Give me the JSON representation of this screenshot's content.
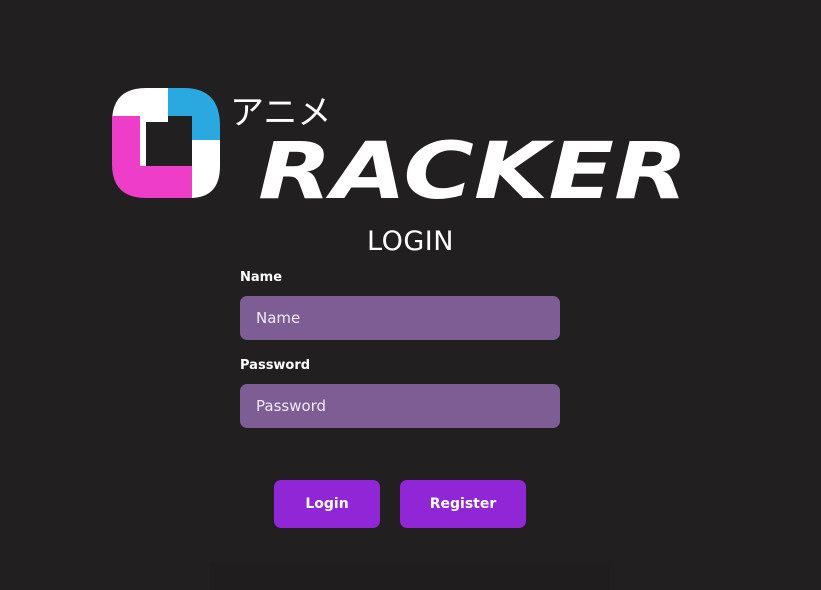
{
  "brand": {
    "kana": "アニメ",
    "wordmark": "RACKER",
    "colors": {
      "blue": "#2aa8e0",
      "pink": "#ee3ec9",
      "white": "#ffffff"
    }
  },
  "page": {
    "title": "LOGIN",
    "background": "#211f1f"
  },
  "form": {
    "name_label": "Name",
    "name_placeholder": "Name",
    "name_value": "",
    "password_label": "Password",
    "password_placeholder": "Password",
    "password_value": "",
    "field_color": "#7d5d93"
  },
  "actions": {
    "login_label": "Login",
    "register_label": "Register",
    "button_color": "#9026d6"
  }
}
